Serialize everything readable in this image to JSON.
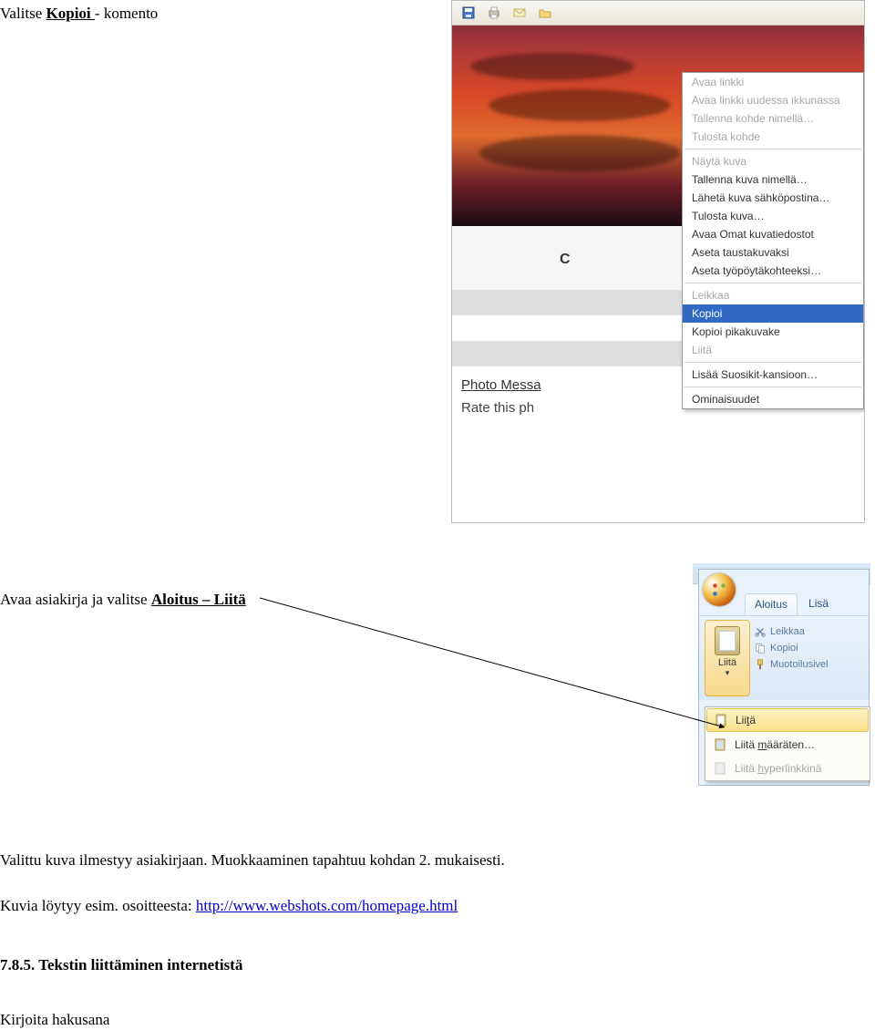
{
  "text": {
    "line1_pre": "Valitse ",
    "line1_mid": "Kopioi ",
    "line1_post": "- komento",
    "line2_pre": "Avaa asiakirja ja valitse ",
    "line2_link": "Aloitus – Liitä",
    "para3": "Valittu kuva ilmestyy asiakirjaan. Muokkaaminen tapahtuu kohdan 2. mukaisesti.",
    "para4_pre": "Kuvia löytyy esim. osoitteesta: ",
    "para4_link": "http://www.webshots.com/homepage.html",
    "heading": "7.8.5. Tekstin liittäminen internetistä",
    "para5": "Kirjoita hakusana"
  },
  "shot1": {
    "below_c": "C",
    "photo_msg": "Photo Messa",
    "rate": "Rate this ph"
  },
  "ctx_menu": [
    {
      "label": "Avaa linkki",
      "state": "disabled"
    },
    {
      "label": "Avaa linkki uudessa ikkunassa",
      "state": "disabled"
    },
    {
      "label": "Tallenna kohde nimellä…",
      "state": "disabled"
    },
    {
      "label": "Tulosta kohde",
      "state": "disabled"
    },
    {
      "sep": true
    },
    {
      "label": "Näytä kuva",
      "state": "disabled"
    },
    {
      "label": "Tallenna kuva nimellä…",
      "state": ""
    },
    {
      "label": "Lähetä kuva sähköpostina…",
      "state": ""
    },
    {
      "label": "Tulosta kuva…",
      "state": ""
    },
    {
      "label": "Avaa Omat kuvatiedostot",
      "state": ""
    },
    {
      "label": "Aseta taustakuvaksi",
      "state": ""
    },
    {
      "label": "Aseta työpöytäkohteeksi…",
      "state": ""
    },
    {
      "sep": true
    },
    {
      "label": "Leikkaa",
      "state": "disabled"
    },
    {
      "label": "Kopioi",
      "state": "highlight"
    },
    {
      "label": "Kopioi pikakuvake",
      "state": ""
    },
    {
      "label": "Liitä",
      "state": "disabled"
    },
    {
      "sep": true
    },
    {
      "label": "Lisää Suosikit-kansioon…",
      "state": ""
    },
    {
      "sep": true
    },
    {
      "label": "Ominaisuudet",
      "state": ""
    }
  ],
  "shot2": {
    "tab1": "Aloitus",
    "tab2": "Lisä",
    "paste_label": "Liitä",
    "cut": "Leikkaa",
    "copy": "Kopioi",
    "format": "Muotoilusivel"
  },
  "paste_menu": {
    "i1_pre": "Lii",
    "i1_u": "t",
    "i1_post": "ä",
    "i2_pre": "Liitä ",
    "i2_u": "m",
    "i2_post": "ääräten…",
    "i3_pre": "Liitä ",
    "i3_u": "h",
    "i3_post": "yperlinkkinä"
  }
}
